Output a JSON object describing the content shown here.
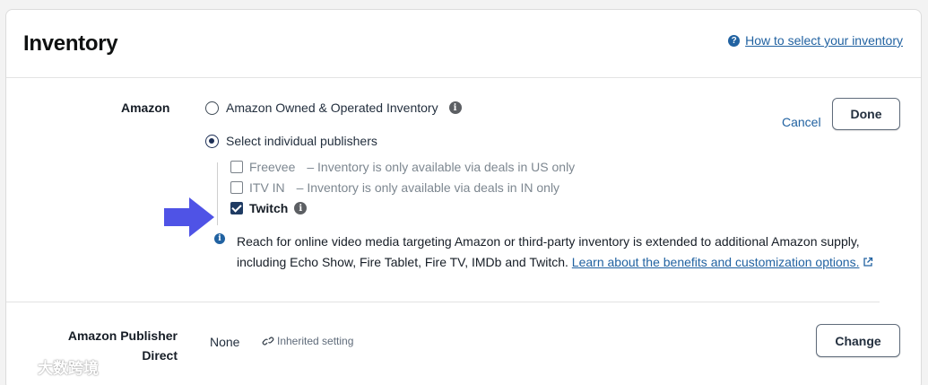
{
  "header": {
    "title": "Inventory",
    "help_link": "How to select your inventory"
  },
  "amazon_row": {
    "label": "Amazon",
    "option_owned": "Amazon Owned & Operated Inventory",
    "option_individual": "Select individual publishers",
    "selected": "Select individual publishers",
    "publishers": [
      {
        "name": "Freevee",
        "note": "– Inventory is only available via deals in US only",
        "checked": false
      },
      {
        "name": "ITV IN",
        "note": "– Inventory is only available via deals in IN only",
        "checked": false
      },
      {
        "name": "Twitch",
        "note": "",
        "checked": true
      }
    ],
    "info_text": "Reach for online video media targeting Amazon or third-party inventory is extended to additional Amazon supply, including Echo Show, Fire Tablet, Fire TV, IMDb and Twitch.",
    "info_link": "Learn about the benefits and customization options.",
    "cancel_label": "Cancel",
    "done_label": "Done"
  },
  "publisher_direct_row": {
    "label_line1": "Amazon Publisher",
    "label_line2": "Direct",
    "value": "None",
    "inherited_label": "Inherited setting",
    "change_label": "Change"
  },
  "watermark": "大数跨境",
  "colors": {
    "link": "#2162a1",
    "arrow": "#4f53e6",
    "checkbox_checked": "#1f3b63"
  },
  "icons": [
    "help-icon",
    "info-icon",
    "check-icon",
    "arrow-right-icon",
    "external-link-icon",
    "link-icon"
  ]
}
